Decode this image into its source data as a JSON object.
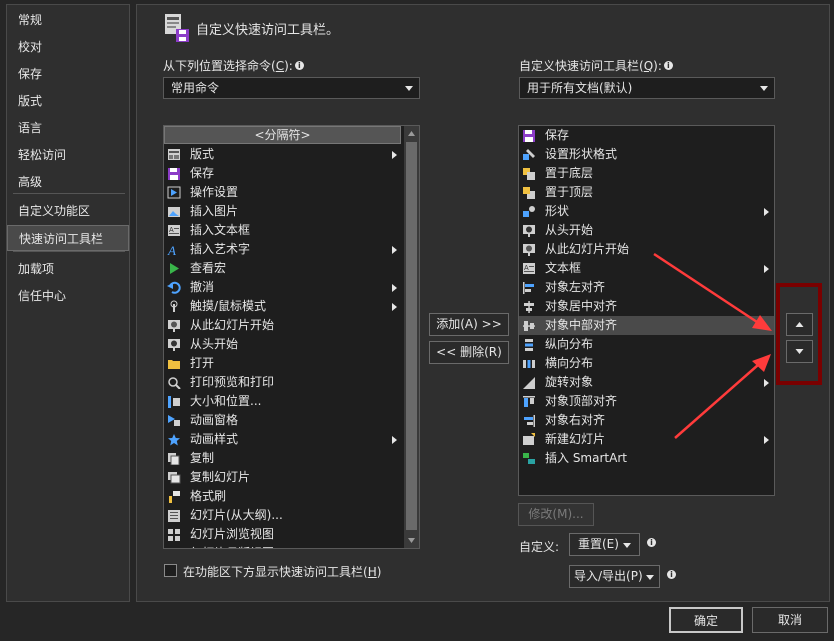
{
  "nav": {
    "items": [
      {
        "label": "常规"
      },
      {
        "label": "校对"
      },
      {
        "label": "保存"
      },
      {
        "label": "版式"
      },
      {
        "label": "语言"
      },
      {
        "label": "轻松访问"
      },
      {
        "label": "高级"
      },
      {
        "label": "自定义功能区"
      },
      {
        "label": "快速访问工具栏"
      },
      {
        "label": "加载项"
      },
      {
        "label": "信任中心"
      }
    ],
    "active_index": 8
  },
  "header": {
    "title": "自定义快速访问工具栏。"
  },
  "left_panel": {
    "label": "从下列位置选择命令(",
    "label_key": "C",
    "label_end": "):",
    "select_value": "常用命令",
    "separator_item": "<分隔符>",
    "items": [
      {
        "label": "版式",
        "icon": "layout-icon",
        "sub": true
      },
      {
        "label": "保存",
        "icon": "save-icon",
        "sub": false
      },
      {
        "label": "操作设置",
        "icon": "action-icon",
        "sub": false
      },
      {
        "label": "插入图片",
        "icon": "picture-icon",
        "sub": false
      },
      {
        "label": "插入文本框",
        "icon": "textbox-icon",
        "sub": false
      },
      {
        "label": "插入艺术字",
        "icon": "wordart-icon",
        "sub": true
      },
      {
        "label": "查看宏",
        "icon": "macro-icon",
        "sub": false
      },
      {
        "label": "撤消",
        "icon": "undo-icon",
        "sub": true
      },
      {
        "label": "触摸/鼠标模式",
        "icon": "touch-icon",
        "sub": true
      },
      {
        "label": "从此幻灯片开始",
        "icon": "slideshow-current-icon",
        "sub": false
      },
      {
        "label": "从头开始",
        "icon": "slideshow-start-icon",
        "sub": false
      },
      {
        "label": "打开",
        "icon": "folder-icon",
        "sub": false
      },
      {
        "label": "打印预览和打印",
        "icon": "print-icon",
        "sub": false
      },
      {
        "label": "大小和位置...",
        "icon": "size-icon",
        "sub": false
      },
      {
        "label": "动画窗格",
        "icon": "animation-pane-icon",
        "sub": false
      },
      {
        "label": "动画样式",
        "icon": "star-icon",
        "sub": true
      },
      {
        "label": "复制",
        "icon": "copy-icon",
        "sub": false
      },
      {
        "label": "复制幻灯片",
        "icon": "duplicate-slide-icon",
        "sub": false
      },
      {
        "label": "格式刷",
        "icon": "format-painter-icon",
        "sub": false
      },
      {
        "label": "幻灯片(从大纲)...",
        "icon": "outline-icon",
        "sub": false
      },
      {
        "label": "幻灯片浏览视图",
        "icon": "sorter-icon",
        "sub": false
      },
      {
        "label": "幻灯片母版视图",
        "icon": "master-icon",
        "sub": false
      }
    ],
    "checkbox_label": "在功能区下方显示快速访问工具栏(",
    "checkbox_key": "H",
    "checkbox_end": ")"
  },
  "middle": {
    "add_label": "添加(A) >>",
    "remove_label": "<< 删除(R)"
  },
  "right_panel": {
    "label": "自定义快速访问工具栏(",
    "label_key": "Q",
    "label_end": "):",
    "select_value": "用于所有文档(默认)",
    "selected_index": 10,
    "items": [
      {
        "label": "保存",
        "icon": "save-icon",
        "sub": false
      },
      {
        "label": "设置形状格式",
        "icon": "shape-format-icon",
        "sub": false
      },
      {
        "label": "置于底层",
        "icon": "send-back-icon",
        "sub": false
      },
      {
        "label": "置于顶层",
        "icon": "bring-front-icon",
        "sub": false
      },
      {
        "label": "形状",
        "icon": "shapes-icon",
        "sub": true
      },
      {
        "label": "从头开始",
        "icon": "slideshow-start-icon",
        "sub": false
      },
      {
        "label": "从此幻灯片开始",
        "icon": "slideshow-current-icon",
        "sub": false
      },
      {
        "label": "文本框",
        "icon": "textbox-icon",
        "sub": true
      },
      {
        "label": "对象左对齐",
        "icon": "align-left-icon",
        "sub": false
      },
      {
        "label": "对象居中对齐",
        "icon": "align-center-icon",
        "sub": false
      },
      {
        "label": "对象中部对齐",
        "icon": "align-middle-icon",
        "sub": false
      },
      {
        "label": "纵向分布",
        "icon": "distribute-vertical-icon",
        "sub": false
      },
      {
        "label": "横向分布",
        "icon": "distribute-horizontal-icon",
        "sub": false
      },
      {
        "label": "旋转对象",
        "icon": "rotate-icon",
        "sub": true
      },
      {
        "label": "对象顶部对齐",
        "icon": "align-top-icon",
        "sub": false
      },
      {
        "label": "对象右对齐",
        "icon": "align-right-icon",
        "sub": false
      },
      {
        "label": "新建幻灯片",
        "icon": "new-slide-icon",
        "sub": true
      },
      {
        "label": "插入 SmartArt",
        "icon": "smartart-icon",
        "sub": false
      }
    ],
    "modify_label": "修改(M)...",
    "custom_label": "自定义:",
    "reset_label": "重置(E)",
    "import_export_label": "导入/导出(P)"
  },
  "footer": {
    "ok_label": "确定",
    "cancel_label": "取消"
  },
  "colors": {
    "highlight_box": "#7a0000",
    "arrow": "#ff3b3b"
  }
}
